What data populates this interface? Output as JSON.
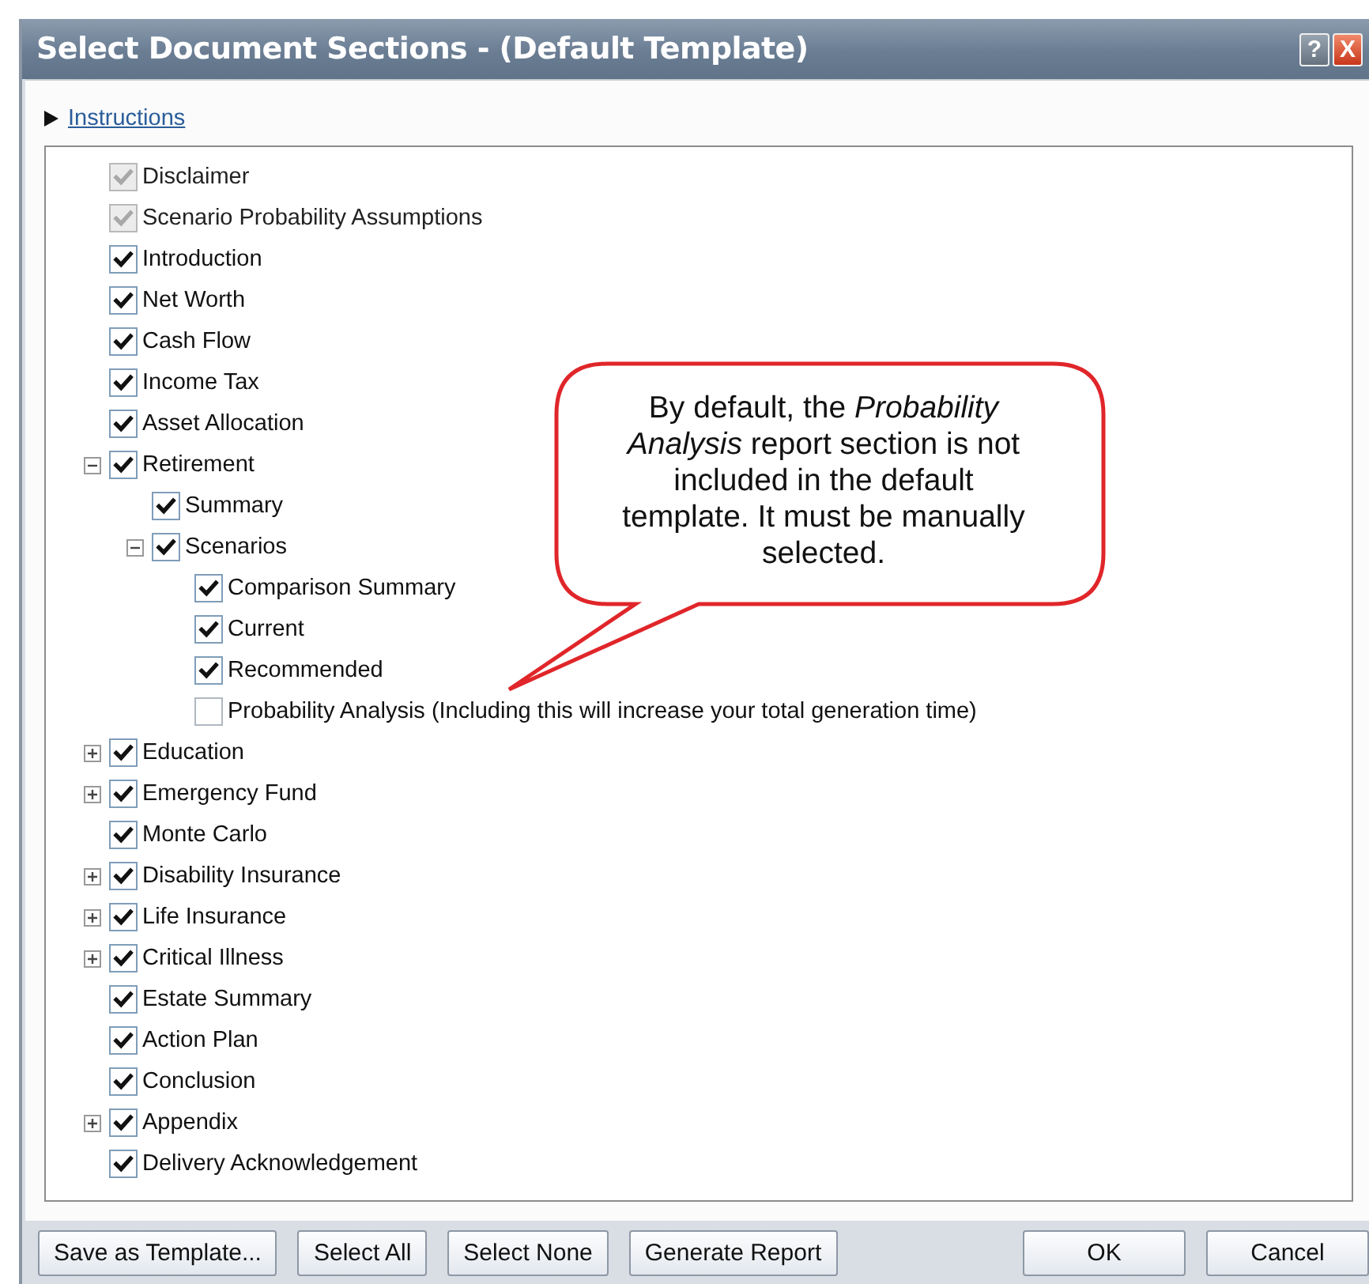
{
  "window": {
    "title": "Select Document Sections - (Default Template)",
    "title_buttons": [
      {
        "kind": "help",
        "label": "?"
      },
      {
        "kind": "close",
        "label": "X"
      }
    ]
  },
  "instructions_link": "Instructions",
  "sections": [
    {
      "label": "Disclaimer",
      "checked": true,
      "disabled": true
    },
    {
      "label": "Scenario Probability Assumptions",
      "checked": true,
      "disabled": true
    },
    {
      "label": "Introduction",
      "checked": true,
      "disabled": false
    },
    {
      "label": "Net Worth",
      "checked": true,
      "disabled": false
    },
    {
      "label": "Cash Flow",
      "checked": true,
      "disabled": false
    },
    {
      "label": "Income Tax",
      "checked": true,
      "disabled": false
    },
    {
      "label": "Asset Allocation",
      "checked": true,
      "disabled": false
    },
    {
      "label": "Retirement",
      "checked": true,
      "disabled": false,
      "expanded": true,
      "children": [
        {
          "label": "Summary",
          "checked": true,
          "disabled": false
        },
        {
          "label": "Scenarios",
          "checked": true,
          "disabled": false,
          "expanded": true,
          "children": [
            {
              "label": "Comparison Summary",
              "checked": true,
              "disabled": false
            },
            {
              "label": "Current",
              "checked": true,
              "disabled": false
            },
            {
              "label": "Recommended",
              "checked": true,
              "disabled": false
            },
            {
              "label": "Probability Analysis (Including this will increase your total generation time)",
              "checked": false,
              "disabled": false
            }
          ]
        }
      ]
    },
    {
      "label": "Education",
      "checked": true,
      "disabled": false,
      "expanded": false
    },
    {
      "label": "Emergency Fund",
      "checked": true,
      "disabled": false,
      "expanded": false
    },
    {
      "label": "Monte Carlo",
      "checked": true,
      "disabled": false
    },
    {
      "label": "Disability Insurance",
      "checked": true,
      "disabled": false,
      "expanded": false
    },
    {
      "label": "Life Insurance",
      "checked": true,
      "disabled": false,
      "expanded": false
    },
    {
      "label": "Critical Illness",
      "checked": true,
      "disabled": false,
      "expanded": false
    },
    {
      "label": "Estate Summary",
      "checked": true,
      "disabled": false
    },
    {
      "label": "Action Plan",
      "checked": true,
      "disabled": false
    },
    {
      "label": "Conclusion",
      "checked": true,
      "disabled": false
    },
    {
      "label": "Appendix",
      "checked": true,
      "disabled": false,
      "expanded": false
    },
    {
      "label": "Delivery Acknowledgement",
      "checked": true,
      "disabled": false
    }
  ],
  "callout": {
    "text": "By default, the *Probability Analysis* report section is not included in the default template. It must be manually selected."
  },
  "buttons_left": [
    "Save as Template...",
    "Select All",
    "Select None",
    "Generate Report"
  ],
  "buttons_right": [
    "OK",
    "Cancel"
  ]
}
